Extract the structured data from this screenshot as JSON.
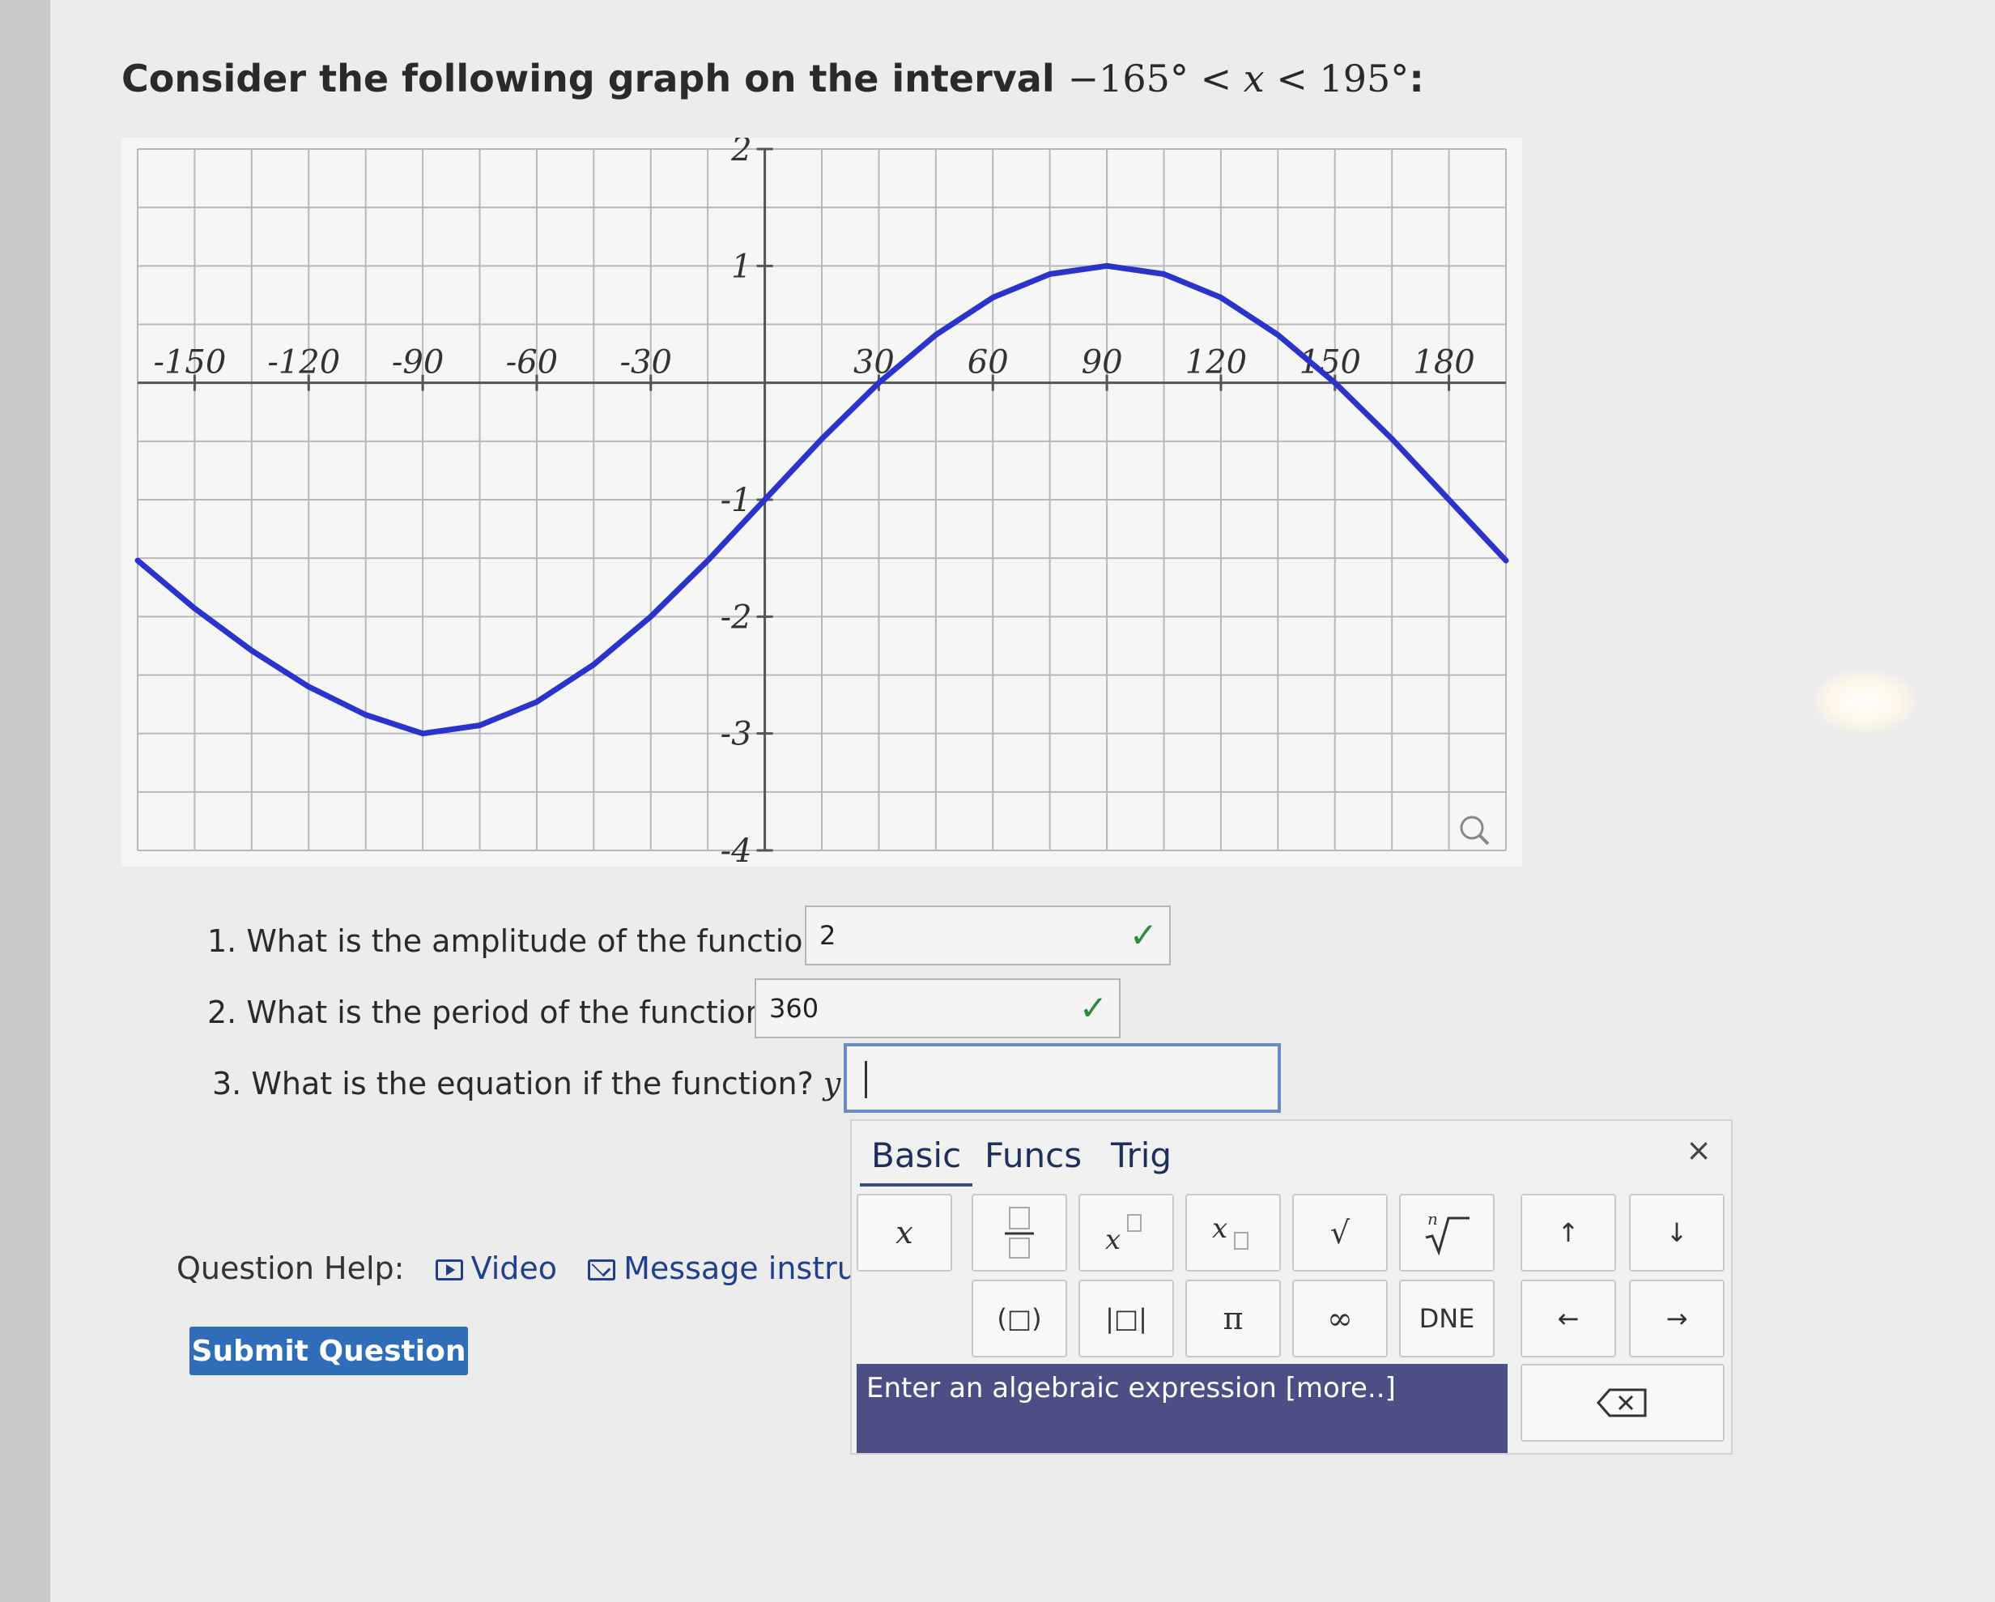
{
  "prompt": {
    "text": "Consider the following graph on the interval ",
    "lhs": "−165°",
    "lt1": "<",
    "var": "x",
    "lt2": "<",
    "rhs": "195°",
    "colon": ":"
  },
  "chart_data": {
    "type": "line",
    "title": "",
    "xlabel": "",
    "ylabel": "",
    "xlim": [
      -165,
      195
    ],
    "ylim": [
      -4,
      2
    ],
    "x_tick_labels": [
      "-150",
      "-120",
      "-90",
      "-60",
      "-30",
      "30",
      "60",
      "90",
      "120",
      "150",
      "180"
    ],
    "y_tick_labels": [
      "2",
      "1",
      "-1",
      "-2",
      "-3",
      "-4"
    ],
    "grid": true,
    "line_color": "#2a33cc",
    "series": [
      {
        "x": [
          -165,
          -150,
          -135,
          -120,
          -105,
          -90,
          -75,
          -60,
          -45,
          -30,
          -15,
          0,
          15,
          30,
          45,
          60,
          75,
          90,
          105,
          120,
          135,
          150,
          165,
          180,
          195
        ],
        "y": [
          -1.52,
          -1.93,
          -2.29,
          -2.6,
          -2.84,
          -3.0,
          -2.93,
          -2.73,
          -2.41,
          -2.0,
          -1.52,
          -1.0,
          -0.48,
          0.0,
          0.41,
          0.73,
          0.93,
          1.0,
          0.93,
          0.73,
          0.41,
          0.0,
          -0.48,
          -1.0,
          -1.52
        ]
      }
    ]
  },
  "questions": [
    {
      "num": "1.",
      "text": "What is the amplitude of the function?",
      "answer": "2",
      "status": "correct"
    },
    {
      "num": "2.",
      "text": "What is the period of the function?",
      "answer": "360",
      "status": "correct"
    },
    {
      "num": "3.",
      "text": "What is the equation if the function?",
      "var": "y",
      "eq": "=",
      "answer": ""
    }
  ],
  "check_glyph": "✓",
  "help": {
    "label": "Question Help:",
    "video": "Video",
    "message": "Message instructor"
  },
  "submit_label": "Submit Question",
  "keyboard": {
    "tabs": [
      "Basic",
      "Funcs",
      "Trig"
    ],
    "close": "×",
    "keys_row1": [
      "x",
      "fraction",
      "power",
      "subscript",
      "√",
      "nthroot",
      "↑",
      "↓"
    ],
    "keys_row2": [
      "(□)",
      "|□|",
      "π",
      "∞",
      "DNE",
      "←",
      "→"
    ],
    "hint": "Enter an algebraic expression [more..]",
    "backspace_icon": "backspace-icon"
  }
}
